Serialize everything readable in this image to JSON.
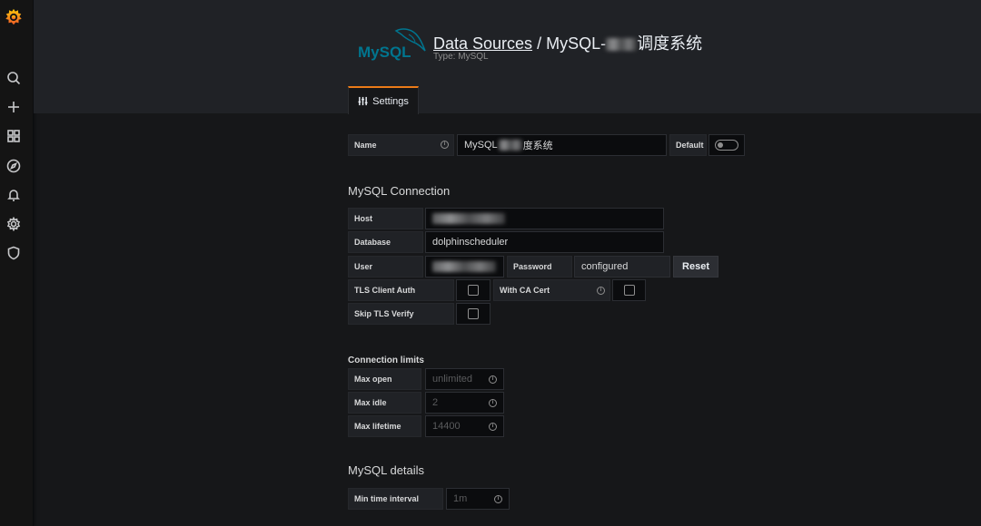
{
  "header": {
    "breadcrumb": "Data Sources",
    "separator": " / ",
    "title_prefix": "MySQL-",
    "title_suffix": "调度系统",
    "subtitle": "Type: MySQL",
    "logo_text": "MySQL"
  },
  "tabs": [
    {
      "label": "Settings",
      "icon": "sliders-icon"
    }
  ],
  "name_row": {
    "label": "Name",
    "value_prefix": "MySQL",
    "value_suffix": "度系统",
    "default_label": "Default",
    "default_on": false
  },
  "connection": {
    "title": "MySQL Connection",
    "host_label": "Host",
    "database_label": "Database",
    "database_value": "dolphinscheduler",
    "user_label": "User",
    "password_label": "Password",
    "password_value": "configured",
    "reset_label": "Reset",
    "tls_client_auth_label": "TLS Client Auth",
    "with_ca_cert_label": "With CA Cert",
    "skip_tls_verify_label": "Skip TLS Verify"
  },
  "limits": {
    "title": "Connection limits",
    "max_open_label": "Max open",
    "max_open_placeholder": "unlimited",
    "max_idle_label": "Max idle",
    "max_idle_placeholder": "2",
    "max_lifetime_label": "Max lifetime",
    "max_lifetime_placeholder": "14400"
  },
  "details": {
    "title": "MySQL details",
    "min_interval_label": "Min time interval",
    "min_interval_placeholder": "1m"
  },
  "sidebar": {
    "icons": [
      "grafana-logo",
      "search-icon",
      "plus-icon",
      "dashboards-icon",
      "explore-icon",
      "alert-bell-icon",
      "gear-icon",
      "shield-icon"
    ]
  },
  "colors": {
    "accent": "#eb7b18",
    "page_bg": "#161719",
    "header_bg": "#202226",
    "mysql_blue": "#00758f",
    "mysql_orange": "#f29111"
  }
}
